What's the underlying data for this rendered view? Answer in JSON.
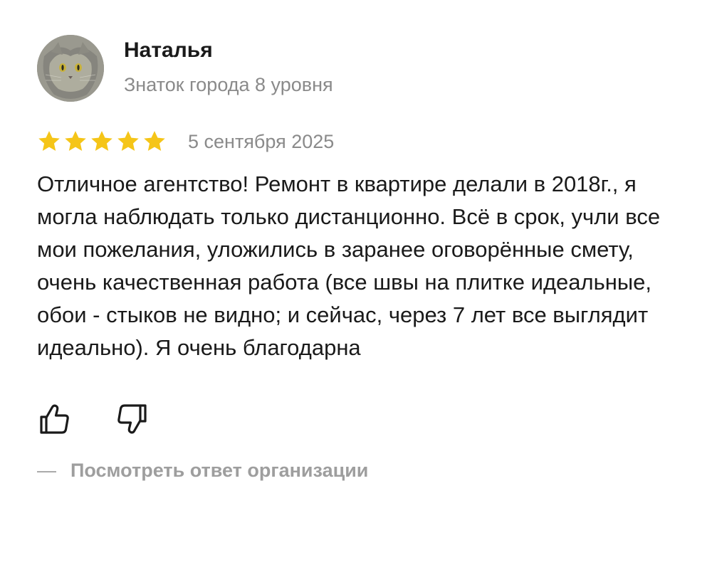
{
  "author": {
    "name": "Наталья",
    "level": "Знаток города 8 уровня",
    "avatar_icon": "cat-photo-avatar"
  },
  "rating": {
    "value": 5,
    "max": 5,
    "star_color": "#f5c518"
  },
  "review": {
    "date": "5 сентября 2025",
    "text": "Отличное агентство! Ремонт в квартире делали в 2018г., я могла наблюдать только дистанционно. Всё в срок, учли все мои пожелания, уложились в заранее оговорённые смету, очень качественная работа (все швы на плитке идеальные, обои - стыков не видно; и сейчас, через 7 лет все выглядит идеально). Я очень благодарна"
  },
  "reactions": {
    "like_icon": "thumbs-up-icon",
    "dislike_icon": "thumbs-down-icon"
  },
  "org_reply": {
    "dash": "—",
    "label": "Посмотреть ответ организации"
  },
  "colors": {
    "text": "#1a1a1a",
    "secondary": "#8a8a8a",
    "muted_link": "#9e9e9e",
    "star": "#f5c518"
  }
}
